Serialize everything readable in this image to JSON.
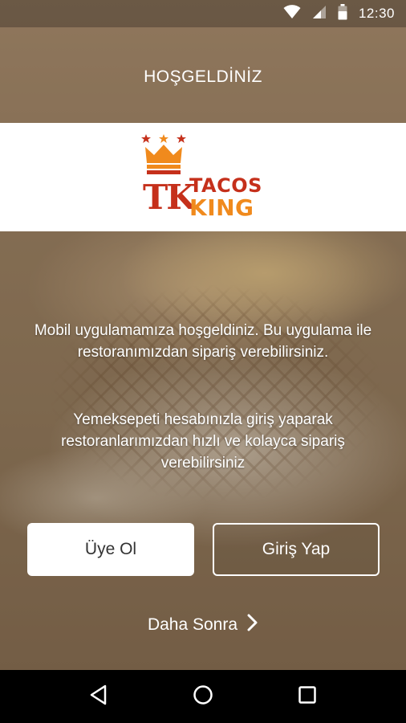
{
  "status_bar": {
    "time": "12:30",
    "icons": [
      "wifi-icon",
      "signal-icon",
      "battery-icon"
    ]
  },
  "header": {
    "title": "HOŞGELDİNİZ"
  },
  "logo": {
    "mark": "TK",
    "line1": "TACOS",
    "line2": "KING",
    "colors": {
      "red": "#c5301b",
      "orange": "#f08a1d"
    }
  },
  "body": {
    "intro": "Mobil uygulamamıza hoşgeldiniz. Bu uygulama ile restoranımızdan sipariş verebilirsiniz.",
    "info": "Yemeksepeti hesabınızla giriş yaparak restoranlarımızdan hızlı ve kolayca sipariş verebilirsiniz"
  },
  "actions": {
    "signup_label": "Üye Ol",
    "login_label": "Giriş Yap",
    "later_label": "Daha Sonra"
  },
  "nav": {
    "icons": [
      "back-icon",
      "home-icon",
      "recents-icon"
    ]
  }
}
